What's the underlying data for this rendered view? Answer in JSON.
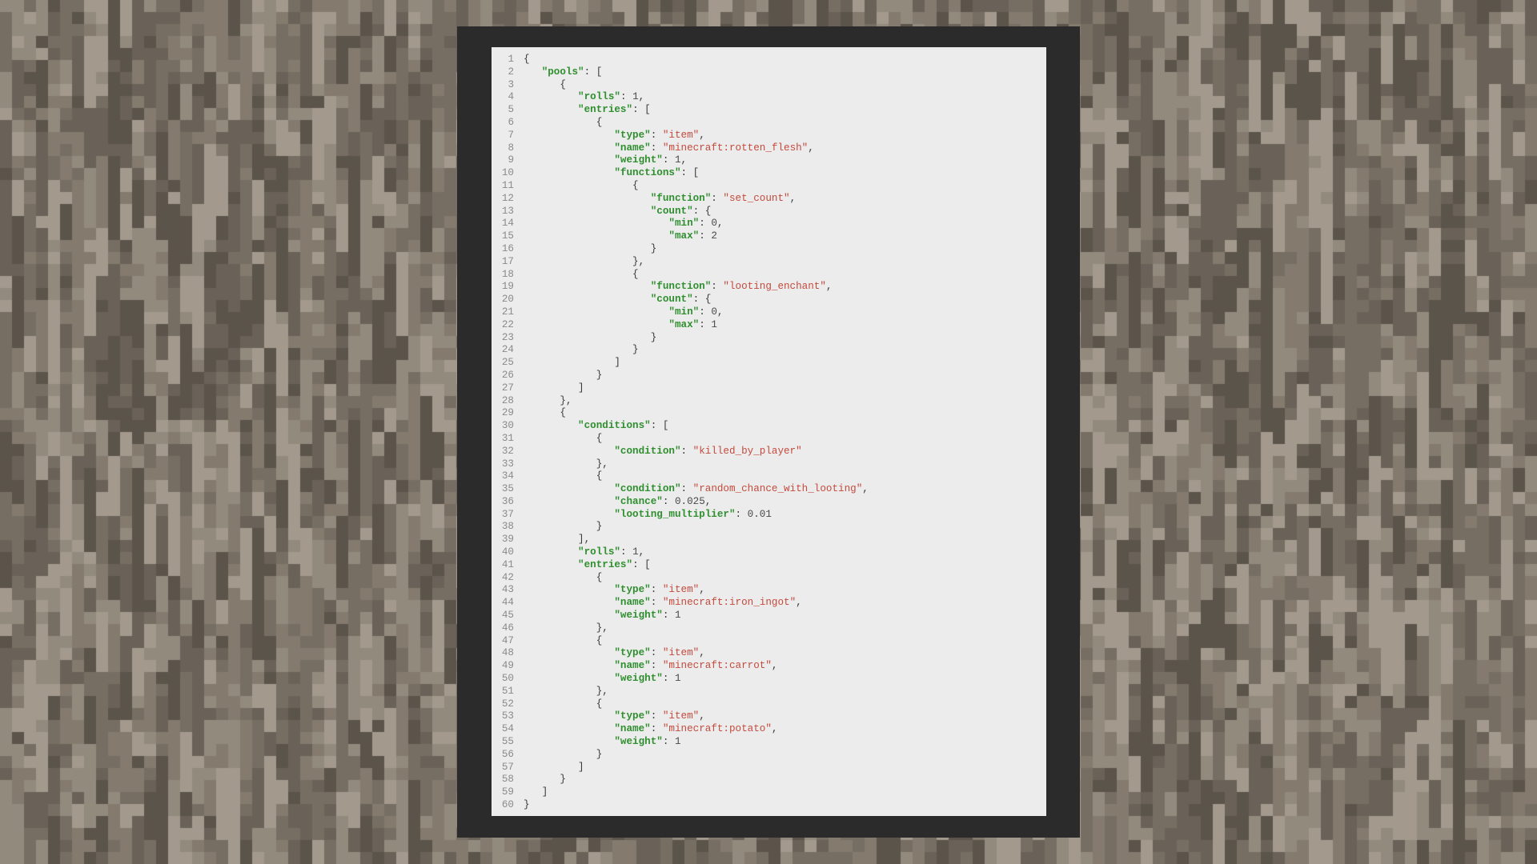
{
  "colors": {
    "frame": "#2b2b2b",
    "panel": "#ececec",
    "key": "#2f8f2f",
    "string": "#c44a3d",
    "line_number": "#8a8a8a"
  },
  "background": {
    "texture": "pixelated-gravel-tiles",
    "palette": [
      "#5b544b",
      "#6a6258",
      "#776e63",
      "#847a6e",
      "#938a7e",
      "#a3998d"
    ]
  },
  "editor": {
    "lines": [
      {
        "n": "1",
        "indent": 0,
        "tokens": [
          {
            "t": "p",
            "v": "{"
          }
        ]
      },
      {
        "n": "2",
        "indent": 1,
        "tokens": [
          {
            "t": "k",
            "v": "\"pools\""
          },
          {
            "t": "p",
            "v": ": ["
          }
        ]
      },
      {
        "n": "3",
        "indent": 2,
        "tokens": [
          {
            "t": "p",
            "v": "{"
          }
        ]
      },
      {
        "n": "4",
        "indent": 3,
        "tokens": [
          {
            "t": "k",
            "v": "\"rolls\""
          },
          {
            "t": "p",
            "v": ": "
          },
          {
            "t": "n",
            "v": "1"
          },
          {
            "t": "p",
            "v": ","
          }
        ]
      },
      {
        "n": "5",
        "indent": 3,
        "tokens": [
          {
            "t": "k",
            "v": "\"entries\""
          },
          {
            "t": "p",
            "v": ": ["
          }
        ]
      },
      {
        "n": "6",
        "indent": 4,
        "tokens": [
          {
            "t": "p",
            "v": "{"
          }
        ]
      },
      {
        "n": "7",
        "indent": 5,
        "tokens": [
          {
            "t": "k",
            "v": "\"type\""
          },
          {
            "t": "p",
            "v": ": "
          },
          {
            "t": "s",
            "v": "\"item\""
          },
          {
            "t": "p",
            "v": ","
          }
        ]
      },
      {
        "n": "8",
        "indent": 5,
        "tokens": [
          {
            "t": "k",
            "v": "\"name\""
          },
          {
            "t": "p",
            "v": ": "
          },
          {
            "t": "s",
            "v": "\"minecraft:rotten_flesh\""
          },
          {
            "t": "p",
            "v": ","
          }
        ]
      },
      {
        "n": "9",
        "indent": 5,
        "tokens": [
          {
            "t": "k",
            "v": "\"weight\""
          },
          {
            "t": "p",
            "v": ": "
          },
          {
            "t": "n",
            "v": "1"
          },
          {
            "t": "p",
            "v": ","
          }
        ]
      },
      {
        "n": "10",
        "indent": 5,
        "tokens": [
          {
            "t": "k",
            "v": "\"functions\""
          },
          {
            "t": "p",
            "v": ": ["
          }
        ]
      },
      {
        "n": "11",
        "indent": 6,
        "tokens": [
          {
            "t": "p",
            "v": "{"
          }
        ]
      },
      {
        "n": "12",
        "indent": 7,
        "tokens": [
          {
            "t": "k",
            "v": "\"function\""
          },
          {
            "t": "p",
            "v": ": "
          },
          {
            "t": "s",
            "v": "\"set_count\""
          },
          {
            "t": "p",
            "v": ","
          }
        ]
      },
      {
        "n": "13",
        "indent": 7,
        "tokens": [
          {
            "t": "k",
            "v": "\"count\""
          },
          {
            "t": "p",
            "v": ": {"
          }
        ]
      },
      {
        "n": "14",
        "indent": 8,
        "tokens": [
          {
            "t": "k",
            "v": "\"min\""
          },
          {
            "t": "p",
            "v": ": "
          },
          {
            "t": "n",
            "v": "0"
          },
          {
            "t": "p",
            "v": ","
          }
        ]
      },
      {
        "n": "15",
        "indent": 8,
        "tokens": [
          {
            "t": "k",
            "v": "\"max\""
          },
          {
            "t": "p",
            "v": ": "
          },
          {
            "t": "n",
            "v": "2"
          }
        ]
      },
      {
        "n": "16",
        "indent": 7,
        "tokens": [
          {
            "t": "p",
            "v": "}"
          }
        ]
      },
      {
        "n": "17",
        "indent": 6,
        "tokens": [
          {
            "t": "p",
            "v": "},"
          }
        ]
      },
      {
        "n": "18",
        "indent": 6,
        "tokens": [
          {
            "t": "p",
            "v": "{"
          }
        ]
      },
      {
        "n": "19",
        "indent": 7,
        "tokens": [
          {
            "t": "k",
            "v": "\"function\""
          },
          {
            "t": "p",
            "v": ": "
          },
          {
            "t": "s",
            "v": "\"looting_enchant\""
          },
          {
            "t": "p",
            "v": ","
          }
        ]
      },
      {
        "n": "20",
        "indent": 7,
        "tokens": [
          {
            "t": "k",
            "v": "\"count\""
          },
          {
            "t": "p",
            "v": ": {"
          }
        ]
      },
      {
        "n": "21",
        "indent": 8,
        "tokens": [
          {
            "t": "k",
            "v": "\"min\""
          },
          {
            "t": "p",
            "v": ": "
          },
          {
            "t": "n",
            "v": "0"
          },
          {
            "t": "p",
            "v": ","
          }
        ]
      },
      {
        "n": "22",
        "indent": 8,
        "tokens": [
          {
            "t": "k",
            "v": "\"max\""
          },
          {
            "t": "p",
            "v": ": "
          },
          {
            "t": "n",
            "v": "1"
          }
        ]
      },
      {
        "n": "23",
        "indent": 7,
        "tokens": [
          {
            "t": "p",
            "v": "}"
          }
        ]
      },
      {
        "n": "24",
        "indent": 6,
        "tokens": [
          {
            "t": "p",
            "v": "}"
          }
        ]
      },
      {
        "n": "25",
        "indent": 5,
        "tokens": [
          {
            "t": "p",
            "v": "]"
          }
        ]
      },
      {
        "n": "26",
        "indent": 4,
        "tokens": [
          {
            "t": "p",
            "v": "}"
          }
        ]
      },
      {
        "n": "27",
        "indent": 3,
        "tokens": [
          {
            "t": "p",
            "v": "]"
          }
        ]
      },
      {
        "n": "28",
        "indent": 2,
        "tokens": [
          {
            "t": "p",
            "v": "},"
          }
        ]
      },
      {
        "n": "29",
        "indent": 2,
        "tokens": [
          {
            "t": "p",
            "v": "{"
          }
        ]
      },
      {
        "n": "30",
        "indent": 3,
        "tokens": [
          {
            "t": "k",
            "v": "\"conditions\""
          },
          {
            "t": "p",
            "v": ": ["
          }
        ]
      },
      {
        "n": "31",
        "indent": 4,
        "tokens": [
          {
            "t": "p",
            "v": "{"
          }
        ]
      },
      {
        "n": "32",
        "indent": 5,
        "tokens": [
          {
            "t": "k",
            "v": "\"condition\""
          },
          {
            "t": "p",
            "v": ": "
          },
          {
            "t": "s",
            "v": "\"killed_by_player\""
          }
        ]
      },
      {
        "n": "33",
        "indent": 4,
        "tokens": [
          {
            "t": "p",
            "v": "},"
          }
        ]
      },
      {
        "n": "34",
        "indent": 4,
        "tokens": [
          {
            "t": "p",
            "v": "{"
          }
        ]
      },
      {
        "n": "35",
        "indent": 5,
        "tokens": [
          {
            "t": "k",
            "v": "\"condition\""
          },
          {
            "t": "p",
            "v": ": "
          },
          {
            "t": "s",
            "v": "\"random_chance_with_looting\""
          },
          {
            "t": "p",
            "v": ","
          }
        ]
      },
      {
        "n": "36",
        "indent": 5,
        "tokens": [
          {
            "t": "k",
            "v": "\"chance\""
          },
          {
            "t": "p",
            "v": ": "
          },
          {
            "t": "n",
            "v": "0.025"
          },
          {
            "t": "p",
            "v": ","
          }
        ]
      },
      {
        "n": "37",
        "indent": 5,
        "tokens": [
          {
            "t": "k",
            "v": "\"looting_multiplier\""
          },
          {
            "t": "p",
            "v": ": "
          },
          {
            "t": "n",
            "v": "0.01"
          }
        ]
      },
      {
        "n": "38",
        "indent": 4,
        "tokens": [
          {
            "t": "p",
            "v": "}"
          }
        ]
      },
      {
        "n": "39",
        "indent": 3,
        "tokens": [
          {
            "t": "p",
            "v": "],"
          }
        ]
      },
      {
        "n": "40",
        "indent": 3,
        "tokens": [
          {
            "t": "k",
            "v": "\"rolls\""
          },
          {
            "t": "p",
            "v": ": "
          },
          {
            "t": "n",
            "v": "1"
          },
          {
            "t": "p",
            "v": ","
          }
        ]
      },
      {
        "n": "41",
        "indent": 3,
        "tokens": [
          {
            "t": "k",
            "v": "\"entries\""
          },
          {
            "t": "p",
            "v": ": ["
          }
        ]
      },
      {
        "n": "42",
        "indent": 4,
        "tokens": [
          {
            "t": "p",
            "v": "{"
          }
        ]
      },
      {
        "n": "43",
        "indent": 5,
        "tokens": [
          {
            "t": "k",
            "v": "\"type\""
          },
          {
            "t": "p",
            "v": ": "
          },
          {
            "t": "s",
            "v": "\"item\""
          },
          {
            "t": "p",
            "v": ","
          }
        ]
      },
      {
        "n": "44",
        "indent": 5,
        "tokens": [
          {
            "t": "k",
            "v": "\"name\""
          },
          {
            "t": "p",
            "v": ": "
          },
          {
            "t": "s",
            "v": "\"minecraft:iron_ingot\""
          },
          {
            "t": "p",
            "v": ","
          }
        ]
      },
      {
        "n": "45",
        "indent": 5,
        "tokens": [
          {
            "t": "k",
            "v": "\"weight\""
          },
          {
            "t": "p",
            "v": ": "
          },
          {
            "t": "n",
            "v": "1"
          }
        ]
      },
      {
        "n": "46",
        "indent": 4,
        "tokens": [
          {
            "t": "p",
            "v": "},"
          }
        ]
      },
      {
        "n": "47",
        "indent": 4,
        "tokens": [
          {
            "t": "p",
            "v": "{"
          }
        ]
      },
      {
        "n": "48",
        "indent": 5,
        "tokens": [
          {
            "t": "k",
            "v": "\"type\""
          },
          {
            "t": "p",
            "v": ": "
          },
          {
            "t": "s",
            "v": "\"item\""
          },
          {
            "t": "p",
            "v": ","
          }
        ]
      },
      {
        "n": "49",
        "indent": 5,
        "tokens": [
          {
            "t": "k",
            "v": "\"name\""
          },
          {
            "t": "p",
            "v": ": "
          },
          {
            "t": "s",
            "v": "\"minecraft:carrot\""
          },
          {
            "t": "p",
            "v": ","
          }
        ]
      },
      {
        "n": "50",
        "indent": 5,
        "tokens": [
          {
            "t": "k",
            "v": "\"weight\""
          },
          {
            "t": "p",
            "v": ": "
          },
          {
            "t": "n",
            "v": "1"
          }
        ]
      },
      {
        "n": "51",
        "indent": 4,
        "tokens": [
          {
            "t": "p",
            "v": "},"
          }
        ]
      },
      {
        "n": "52",
        "indent": 4,
        "tokens": [
          {
            "t": "p",
            "v": "{"
          }
        ]
      },
      {
        "n": "53",
        "indent": 5,
        "tokens": [
          {
            "t": "k",
            "v": "\"type\""
          },
          {
            "t": "p",
            "v": ": "
          },
          {
            "t": "s",
            "v": "\"item\""
          },
          {
            "t": "p",
            "v": ","
          }
        ]
      },
      {
        "n": "54",
        "indent": 5,
        "tokens": [
          {
            "t": "k",
            "v": "\"name\""
          },
          {
            "t": "p",
            "v": ": "
          },
          {
            "t": "s",
            "v": "\"minecraft:potato\""
          },
          {
            "t": "p",
            "v": ","
          }
        ]
      },
      {
        "n": "55",
        "indent": 5,
        "tokens": [
          {
            "t": "k",
            "v": "\"weight\""
          },
          {
            "t": "p",
            "v": ": "
          },
          {
            "t": "n",
            "v": "1"
          }
        ]
      },
      {
        "n": "56",
        "indent": 4,
        "tokens": [
          {
            "t": "p",
            "v": "}"
          }
        ]
      },
      {
        "n": "57",
        "indent": 3,
        "tokens": [
          {
            "t": "p",
            "v": "]"
          }
        ]
      },
      {
        "n": "58",
        "indent": 2,
        "tokens": [
          {
            "t": "p",
            "v": "}"
          }
        ]
      },
      {
        "n": "59",
        "indent": 1,
        "tokens": [
          {
            "t": "p",
            "v": "]"
          }
        ]
      },
      {
        "n": "60",
        "indent": 0,
        "tokens": [
          {
            "t": "p",
            "v": "}"
          }
        ]
      }
    ]
  }
}
